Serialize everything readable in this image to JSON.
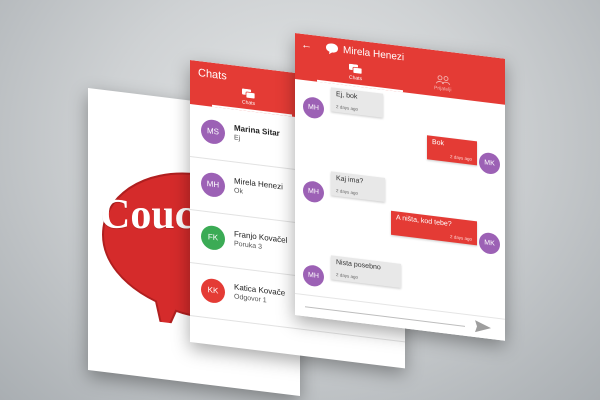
{
  "colors": {
    "accent": "#e43b35",
    "avatar_purple": "#9c61b5",
    "avatar_green": "#3bab55",
    "avatar_red": "#e43b35"
  },
  "logo": {
    "text": "Couc"
  },
  "chat_list": {
    "title": "Chats",
    "tab_label": "Chats",
    "rows": [
      {
        "initials": "MS",
        "name": "Marina Sitar",
        "last": "Ej",
        "avatar_color": "purple",
        "bold": true
      },
      {
        "initials": "MH",
        "name": "Mirela Henezi",
        "last": "Ok",
        "avatar_color": "purple",
        "bold": false
      },
      {
        "initials": "FK",
        "name": "Franjo Kovačel",
        "last": "Poruka 3",
        "avatar_color": "green",
        "bold": false
      },
      {
        "initials": "KK",
        "name": "Katica Kovače",
        "last": "Odgovor 1",
        "avatar_color": "red",
        "bold": false
      }
    ]
  },
  "conversation": {
    "back_icon": "back-arrow-icon",
    "contact_name": "Mirela Henezi",
    "tabs": {
      "chats_label": "Chats",
      "friends_label": "Prijatelji"
    },
    "messages": [
      {
        "from": "MH",
        "text": "Ej, bok",
        "time": "2 days ago",
        "incoming": true
      },
      {
        "from": "MK",
        "text": "Bok",
        "time": "2 days ago",
        "incoming": false
      },
      {
        "from": "MH",
        "text": "Kaj ima?",
        "time": "2 days ago",
        "incoming": true
      },
      {
        "from": "MK",
        "text": "A ništa, kod tebe?",
        "time": "2 days ago",
        "incoming": false
      },
      {
        "from": "MH",
        "text": "Nista posebno",
        "time": "2 days ago",
        "incoming": true
      }
    ],
    "send_icon": "send-icon"
  }
}
